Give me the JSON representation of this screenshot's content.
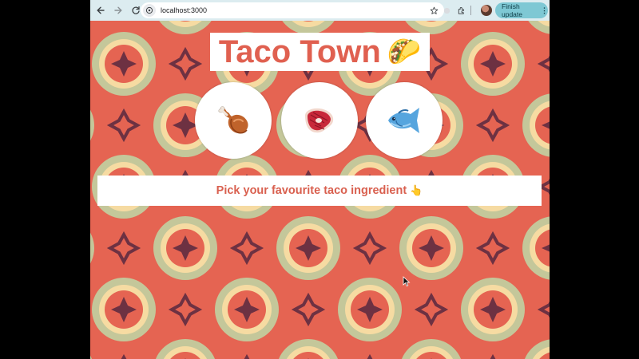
{
  "browser": {
    "url": "localhost:3000",
    "update_button_label": "Finish update",
    "update_button_menu": "⋮"
  },
  "page": {
    "title": "Taco Town",
    "title_emoji": "🌮",
    "prompt": "Pick your favourite taco ingredient",
    "prompt_emoji": "👆",
    "choices": [
      {
        "name": "drumstick",
        "icon": "poultry-leg-icon"
      },
      {
        "name": "steak",
        "icon": "cut-of-meat-icon"
      },
      {
        "name": "fish",
        "icon": "fish-icon"
      }
    ]
  },
  "colors": {
    "background_red": "#e56452",
    "title_red": "#e06050",
    "prompt_red": "#d9604f",
    "pattern_green": "#c4c79a",
    "pattern_cream": "#f6dba2",
    "pattern_purple": "#6d3142",
    "toolbar": "#dcecf0",
    "update_button": "#7ec8d4"
  }
}
